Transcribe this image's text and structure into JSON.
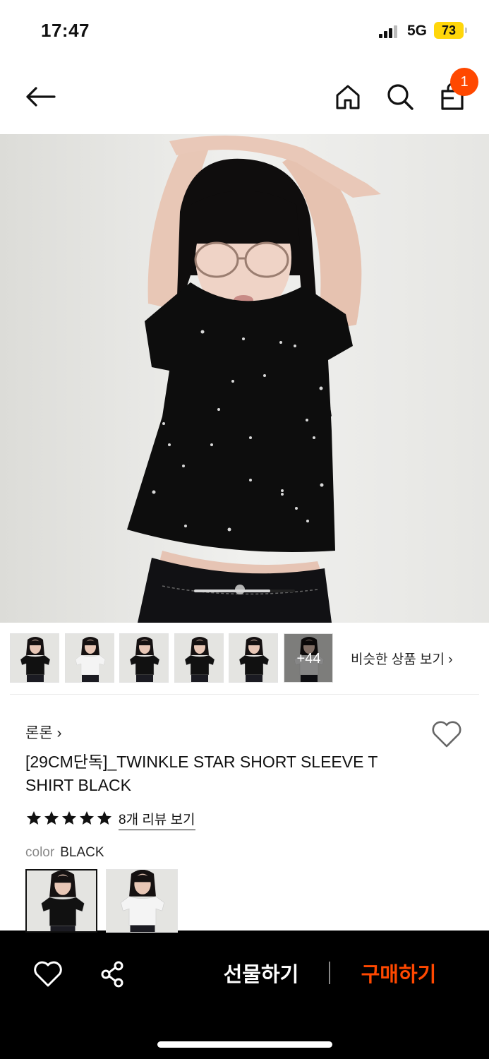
{
  "status": {
    "time": "17:47",
    "network": "5G",
    "battery": "73"
  },
  "nav": {
    "cart_count": "1",
    "icons": [
      "back-arrow-icon",
      "home-icon",
      "search-icon",
      "shopping-bag-icon"
    ]
  },
  "gallery": {
    "thumbnails": [
      {
        "label": "",
        "shirt": "black"
      },
      {
        "label": "",
        "shirt": "white"
      },
      {
        "label": "",
        "shirt": "black"
      },
      {
        "label": "",
        "shirt": "black"
      },
      {
        "label": "",
        "shirt": "black"
      },
      {
        "label": "+44",
        "shirt": "white"
      }
    ],
    "similar_link": "비슷한 상품 보기 ›"
  },
  "product": {
    "brand": "론론 ›",
    "title": "[29CM단독]_TWINKLE STAR SHORT SLEEVE T SHIRT BLACK",
    "rating": 5,
    "review_link": "8개 리뷰 보기",
    "option_label": "color",
    "option_value": "BLACK",
    "color_options": [
      {
        "shirt": "black",
        "selected": true
      },
      {
        "shirt": "white",
        "selected": false
      }
    ]
  },
  "bottom_bar": {
    "gift_label": "선물하기",
    "buy_label": "구매하기"
  },
  "colors": {
    "accent": "#ff4800",
    "battery": "#ffd60a",
    "bottom_bar": "#000000"
  }
}
